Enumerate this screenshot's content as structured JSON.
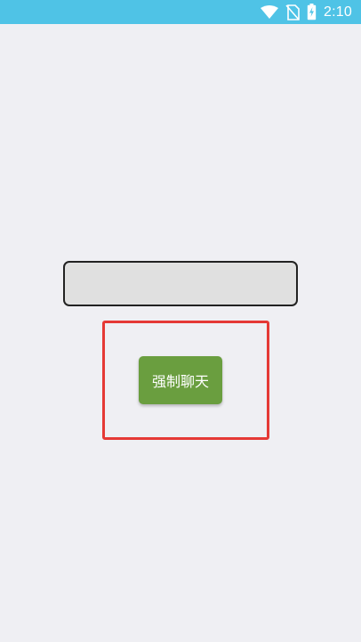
{
  "status_bar": {
    "time": "2:10",
    "icons": [
      "wifi-icon",
      "no-sim-icon",
      "battery-charging-icon"
    ],
    "background": "#4fc3e6"
  },
  "main": {
    "input_value": "",
    "chat_button_label": "强制聊天",
    "button_color": "#6a9e3f",
    "highlight_color": "#e53935"
  }
}
